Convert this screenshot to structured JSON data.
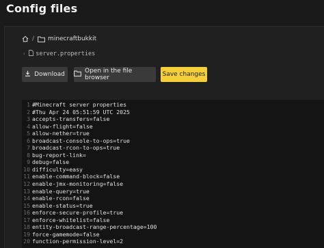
{
  "header": {
    "title": "Config files"
  },
  "breadcrumb": {
    "folder": "minecraftbukkit",
    "separator": "/"
  },
  "file": {
    "name": "server.properties"
  },
  "toolbar": {
    "download_label": "Download",
    "browser_label": "Open in the file browser",
    "save_label": "Save changes"
  },
  "colors": {
    "accent": "#f5cf3a",
    "background": "#1a1a1a",
    "editor_bg": "#141414"
  },
  "editor": {
    "lines": [
      {
        "n": "1",
        "text": "#Minecraft server properties"
      },
      {
        "n": "2",
        "text": "#Thu Apr 24 05:51:59 UTC 2025"
      },
      {
        "n": "3",
        "text": "accepts-transfers=false"
      },
      {
        "n": "4",
        "text": "allow-flight=false"
      },
      {
        "n": "5",
        "text": "allow-nether=true"
      },
      {
        "n": "6",
        "text": "broadcast-console-to-ops=true"
      },
      {
        "n": "7",
        "text": "broadcast-rcon-to-ops=true"
      },
      {
        "n": "8",
        "text": "bug-report-link="
      },
      {
        "n": "9",
        "text": "debug=false"
      },
      {
        "n": "10",
        "text": "difficulty=easy"
      },
      {
        "n": "11",
        "text": "enable-command-block=false"
      },
      {
        "n": "12",
        "text": "enable-jmx-monitoring=false"
      },
      {
        "n": "13",
        "text": "enable-query=true"
      },
      {
        "n": "14",
        "text": "enable-rcon=false"
      },
      {
        "n": "15",
        "text": "enable-status=true"
      },
      {
        "n": "16",
        "text": "enforce-secure-profile=true"
      },
      {
        "n": "17",
        "text": "enforce-whitelist=false"
      },
      {
        "n": "18",
        "text": "entity-broadcast-range-percentage=100"
      },
      {
        "n": "19",
        "text": "force-gamemode=false"
      },
      {
        "n": "20",
        "text": "function-permission-level=2"
      }
    ]
  }
}
